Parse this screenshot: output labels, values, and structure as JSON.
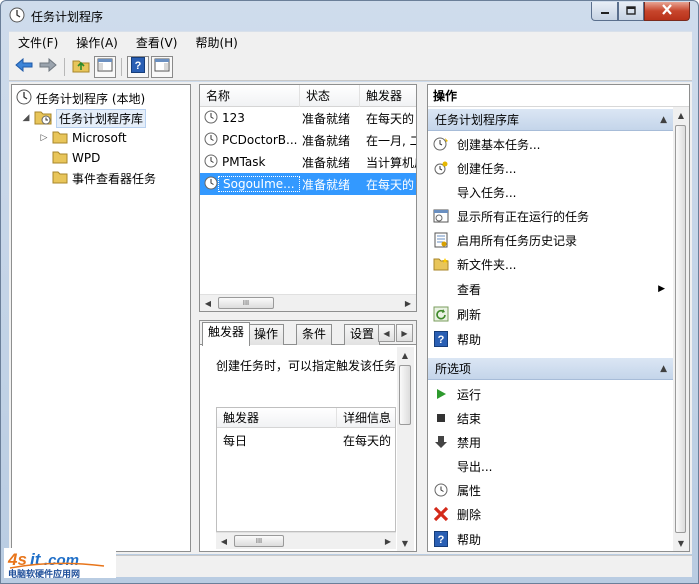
{
  "window": {
    "title": "任务计划程序",
    "controls": {
      "minimize": "minimize",
      "maximize": "maximize",
      "close": "close"
    }
  },
  "menu": [
    "文件(F)",
    "操作(A)",
    "查看(V)",
    "帮助(H)"
  ],
  "toolbar": {
    "icons": [
      "back-arrow-icon",
      "forward-arrow-icon",
      "folder-up-icon",
      "console-tree-icon",
      "help-icon",
      "action-pane-icon"
    ]
  },
  "tree": {
    "root": "任务计划程序 (本地)",
    "library": "任务计划程序库",
    "children": [
      "Microsoft",
      "WPD",
      "事件查看器任务"
    ]
  },
  "task_list": {
    "columns": [
      "名称",
      "状态",
      "触发器"
    ],
    "rows": [
      {
        "name": "123",
        "status": "准备就绪",
        "trigger": "在每天的"
      },
      {
        "name": "PCDoctorB...",
        "status": "准备就绪",
        "trigger": "在一月, 二"
      },
      {
        "name": "PMTask",
        "status": "准备就绪",
        "trigger": "当计算机启"
      },
      {
        "name": "SogouIme...",
        "status": "准备就绪",
        "trigger": "在每天的"
      }
    ],
    "selected_index": 3
  },
  "details": {
    "tabs": [
      "触发器",
      "操作",
      "条件",
      "设置"
    ],
    "active_tab": 0,
    "description": "创建任务时，可以指定触发该任务",
    "columns": [
      "触发器",
      "详细信息"
    ],
    "rows": [
      {
        "trigger": "每日",
        "detail": "在每天的"
      }
    ]
  },
  "actions": {
    "title": "操作",
    "sections": [
      {
        "header": "任务计划程序库",
        "items": [
          {
            "label": "创建基本任务...",
            "icon": "create-basic-task-icon"
          },
          {
            "label": "创建任务...",
            "icon": "create-task-icon"
          },
          {
            "label": "导入任务...",
            "icon": ""
          },
          {
            "label": "显示所有正在运行的任务",
            "icon": "running-tasks-icon"
          },
          {
            "label": "启用所有任务历史记录",
            "icon": "history-icon"
          },
          {
            "label": "新文件夹...",
            "icon": "new-folder-icon"
          },
          {
            "label": "查看",
            "icon": "",
            "submenu": true
          },
          {
            "label": "刷新",
            "icon": "refresh-icon"
          },
          {
            "label": "帮助",
            "icon": "help-icon"
          }
        ]
      },
      {
        "header": "所选项",
        "items": [
          {
            "label": "运行",
            "icon": "run-icon"
          },
          {
            "label": "结束",
            "icon": "end-icon"
          },
          {
            "label": "禁用",
            "icon": "disable-icon"
          },
          {
            "label": "导出...",
            "icon": ""
          },
          {
            "label": "属性",
            "icon": "properties-icon"
          },
          {
            "label": "删除",
            "icon": "delete-icon"
          },
          {
            "label": "帮助",
            "icon": "help-icon"
          }
        ]
      }
    ]
  },
  "watermark": {
    "brand": "4sit.com",
    "text": "电脑软硬件应用网"
  },
  "colors": {
    "selection": "#3399ff",
    "section_header": "#c9d9ec",
    "frame": "#b9cce2"
  }
}
